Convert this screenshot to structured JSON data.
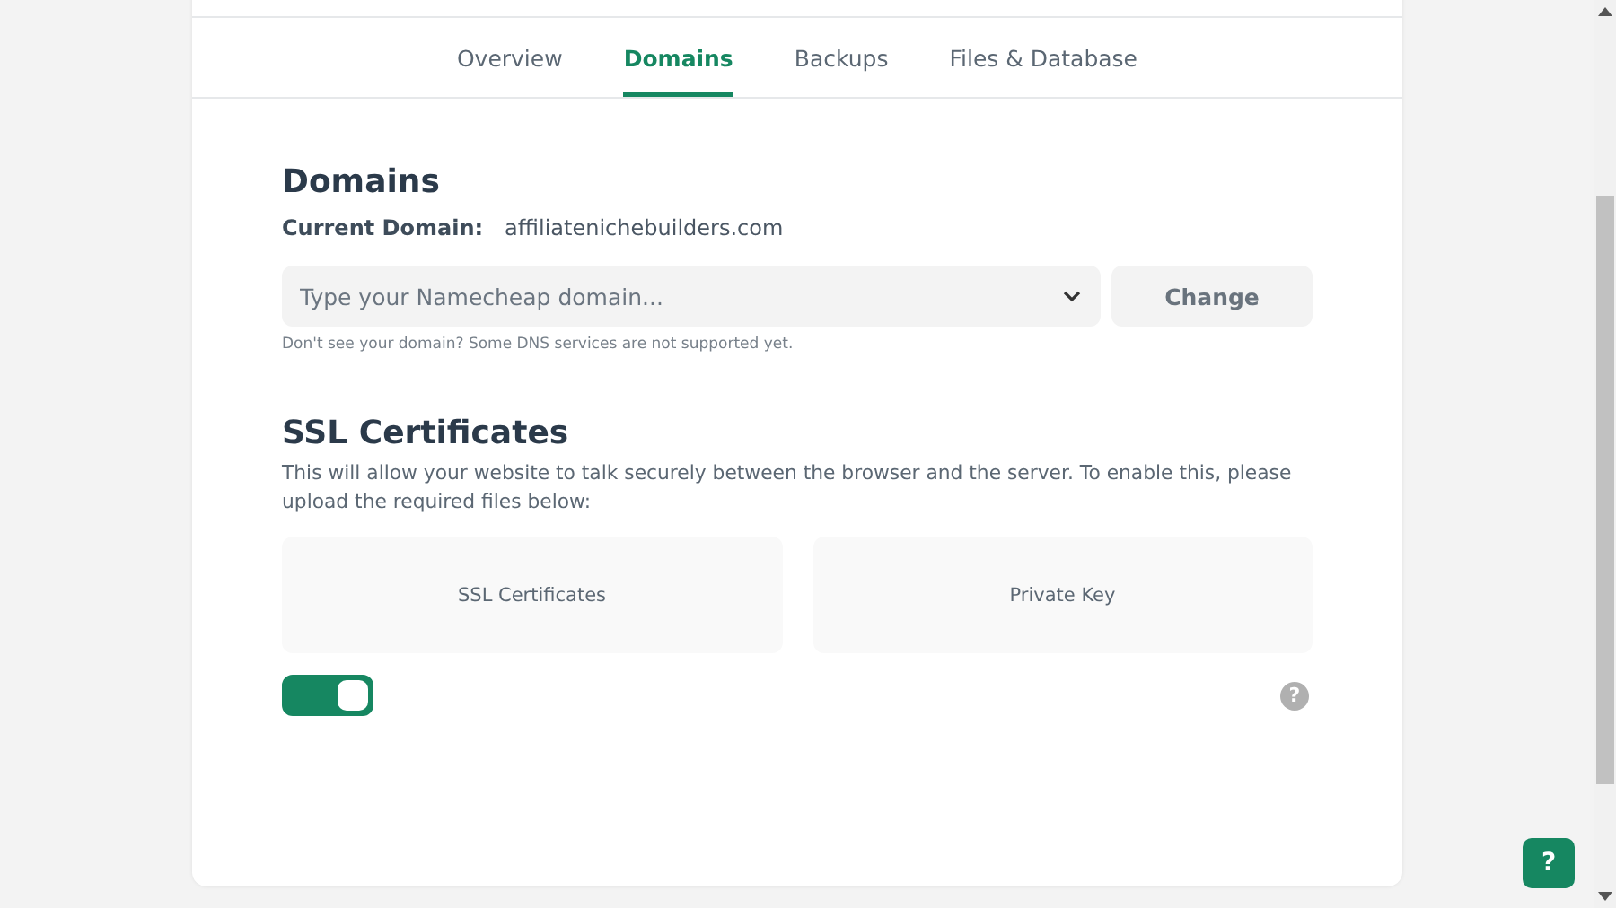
{
  "tabs": [
    {
      "label": "Overview",
      "selected": false
    },
    {
      "label": "Domains",
      "selected": true
    },
    {
      "label": "Backups",
      "selected": false
    },
    {
      "label": "Files & Database",
      "selected": false
    }
  ],
  "domains": {
    "title": "Domains",
    "current_label": "Current Domain:",
    "current_value": "affiliatenichebuilders.com",
    "select": {
      "placeholder": "Type your Namecheap domain..."
    },
    "button": "Change",
    "hint": "Don't see your domain? Some DNS services are not supported yet."
  },
  "ssl": {
    "title": "SSL Certificates",
    "description": "This will allow your website to talk securely between the browser and the server. To enable this, please upload the required files below:",
    "uploads": [
      "SSL Certificates",
      "Private Key"
    ],
    "toggle": {
      "on": true
    },
    "help": "?"
  },
  "help_button": "?"
}
